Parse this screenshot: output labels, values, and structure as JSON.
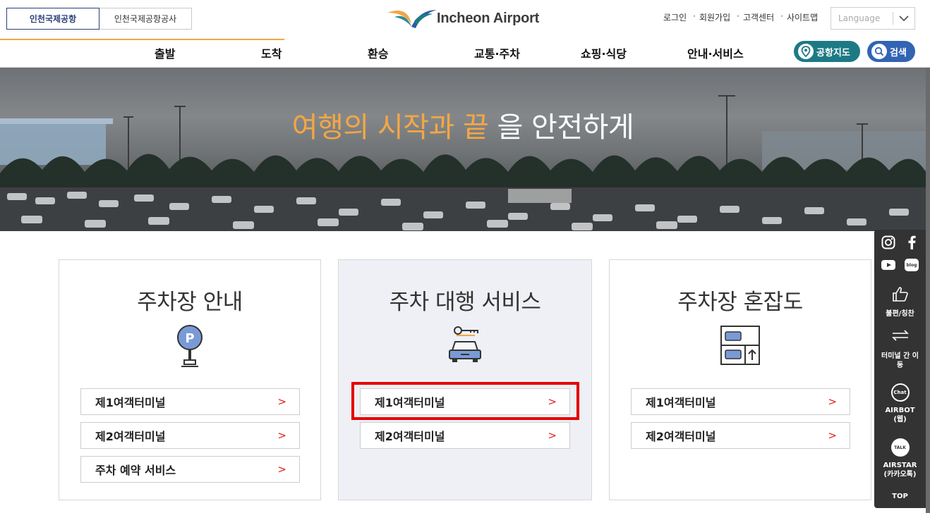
{
  "header": {
    "site_tabs": [
      "인천국제공항",
      "인천국제공항공사"
    ],
    "logo_text": "Incheon Airport",
    "util_links": [
      "로그인",
      "회원가입",
      "고객센터",
      "사이트맵"
    ],
    "language_placeholder": "Language"
  },
  "nav": {
    "items": [
      "출발",
      "도착",
      "환승",
      "교통·주차",
      "쇼핑·식당",
      "안내·서비스"
    ],
    "airport_map": "공항지도",
    "search": "검색"
  },
  "hero": {
    "title_highlight": "여행의 시작과 끝",
    "title_rest": " 을 안전하게"
  },
  "cards": [
    {
      "title": "주차장 안내",
      "icon": "parking-sign-icon",
      "links": [
        "제1여객터미널",
        "제2여객터미널",
        "주차 예약 서비스"
      ]
    },
    {
      "title": "주차 대행 서비스",
      "icon": "car-key-icon",
      "links": [
        "제1여객터미널",
        "제2여객터미널"
      ]
    },
    {
      "title": "주차장 혼잡도",
      "icon": "parking-garage-icon",
      "links": [
        "제1여객터미널",
        "제2여객터미널"
      ]
    }
  ],
  "arrow": ">",
  "quickbar": {
    "social": [
      "instagram-icon",
      "facebook-icon",
      "youtube-icon",
      "blog-icon"
    ],
    "blog_label": "blog",
    "items": [
      {
        "icon": "thumbs-up-icon",
        "label": "불편/칭찬"
      },
      {
        "icon": "transfer-arrows-icon",
        "label": "터미널 간 이동"
      },
      {
        "icon": "chat-bubble-icon",
        "label": "AIRBOT (웹)",
        "badge": "Chat"
      },
      {
        "icon": "kakao-talk-icon",
        "label": "AIRSTAR (카카오톡)",
        "badge": "TALK"
      }
    ],
    "top": "TOP"
  },
  "colors": {
    "accent_orange": "#f3a744",
    "teal": "#1d7a85",
    "blue": "#3264b4",
    "navy": "#2b3f7a",
    "red": "#e60000"
  }
}
